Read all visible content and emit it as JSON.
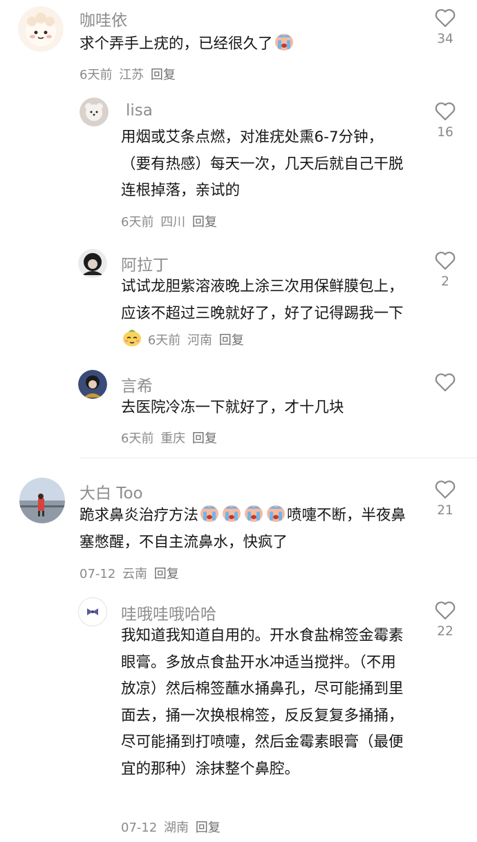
{
  "comments": [
    {
      "username": "咖哇依",
      "text": "求个弄手上疣的，已经很久了",
      "date": "6天前",
      "location": "江苏",
      "reply": "回复",
      "likes": "34"
    },
    {
      "username": "lisa",
      "text": "用烟或艾条点燃，对准疣处熏6-7分钟，（要有热感）每天一次，几天后就自己干脱连根掉落，亲试的",
      "date": "6天前",
      "location": "四川",
      "reply": "回复",
      "likes": "16"
    },
    {
      "username": "阿拉丁",
      "text": "试试龙胆紫溶液晚上涂三次用保鲜膜包上，应该不超过三晚就好了，好了记得踢我一下",
      "date": "6天前",
      "location": "河南",
      "reply": "回复",
      "likes": "2"
    },
    {
      "username": "言希",
      "text": "去医院冷冻一下就好了，才十几块",
      "date": "6天前",
      "location": "重庆",
      "reply": "回复",
      "likes": ""
    },
    {
      "username": "大白 Too",
      "text_a": "跪求鼻炎治疗方法",
      "text_b": "喷嚏不断，半夜鼻塞憋醒，不自主流鼻水，快疯了",
      "date": "07-12",
      "location": "云南",
      "reply": "回复",
      "likes": "21"
    },
    {
      "username": "哇哦哇哦哈哈",
      "text": "我知道我知道自用的。开水食盐棉签金霉素眼膏。多放点食盐开水冲适当搅拌。（不用放凉）然后棉签蘸水捅鼻孔，尽可能捅到里面去，捅一次换根棉签，反反复复多捅捅，尽可能捅到打喷嚏，然后金霉素眼膏（最便宜的那种）涂抹整个鼻腔。",
      "date": "07-12",
      "location": "湖南",
      "reply": "回复",
      "likes": "22"
    }
  ],
  "icons": {
    "like": "heart-outline-icon",
    "cry": "crying-face-emoji",
    "smug": "smug-face-emoji"
  },
  "colors": {
    "username": "#8c8c8c",
    "meta": "#8a8a8a",
    "text": "#161616",
    "emoji_blue": "#6fb6ea",
    "emoji_skin": "#f7b9a0"
  }
}
